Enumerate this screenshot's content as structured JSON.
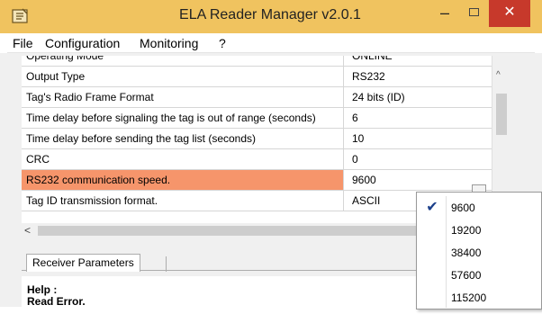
{
  "window": {
    "title": "ELA Reader Manager v2.0.1",
    "app_icon": "reader-app-icon",
    "minimize_icon": "minimize-icon",
    "maximize_icon": "maximize-icon",
    "close_icon": "close-icon",
    "minimize_glyph": "–",
    "close_glyph": "✕"
  },
  "menu": [
    {
      "label": "File"
    },
    {
      "label": "Configuration"
    },
    {
      "label": "Monitoring"
    },
    {
      "label": "?"
    }
  ],
  "grid": {
    "partial_row": {
      "name": "Operating Mode",
      "value": "ONLINE"
    },
    "rows": [
      {
        "name": "Output Type",
        "value": "RS232",
        "selected": false
      },
      {
        "name": "Tag's Radio Frame Format",
        "value": "24 bits (ID)",
        "selected": false
      },
      {
        "name": "Time delay before signaling the tag is out of range (seconds)",
        "value": "6",
        "selected": false
      },
      {
        "name": "Time delay before sending the tag list (seconds)",
        "value": "10",
        "selected": false
      },
      {
        "name": "CRC",
        "value": "0",
        "selected": false
      },
      {
        "name": "RS232 communication speed.",
        "value": "9600",
        "selected": true
      },
      {
        "name": "Tag ID transmission format.",
        "value": "ASCII",
        "selected": false
      }
    ],
    "vscroll_up_glyph": "^",
    "hscroll_left_glyph": "<",
    "selected_color": "#f6956b"
  },
  "tabs": [
    {
      "label": "Receiver Parameters"
    }
  ],
  "help": {
    "title": "Help :",
    "text": "Read Error."
  },
  "dropdown": {
    "check_glyph": "✔",
    "options": [
      {
        "label": "9600",
        "checked": true
      },
      {
        "label": "19200",
        "checked": false
      },
      {
        "label": "38400",
        "checked": false
      },
      {
        "label": "57600",
        "checked": false
      },
      {
        "label": "115200",
        "checked": false
      }
    ]
  },
  "colors": {
    "titlebar": "#f0c35f",
    "close_button": "#c7392b"
  }
}
